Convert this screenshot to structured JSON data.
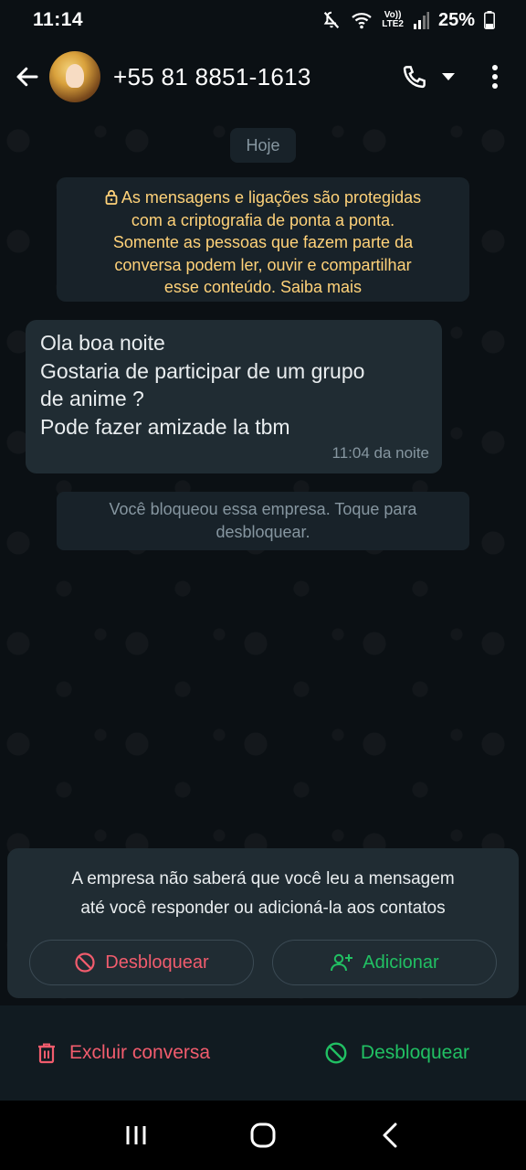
{
  "status_bar": {
    "time": "11:14",
    "network_top": "Vo))",
    "network_bottom": "LTE2",
    "battery": "25%"
  },
  "header": {
    "contact_name": "+55 81 8851-1613",
    "icons": [
      "back-arrow-icon",
      "avatar",
      "phone-icon",
      "dropdown-caret-icon",
      "more-vert-icon"
    ]
  },
  "chat": {
    "date_chip": "Hoje",
    "encryption_notice": [
      "As mensagens e ligações são protegidas",
      "com a criptografia de ponta a ponta.",
      "Somente as pessoas que fazem parte da",
      "conversa podem ler, ouvir e compartilhar",
      "esse conteúdo. Saiba mais"
    ],
    "message": {
      "lines": [
        "Ola boa noite",
        "Gostaria de participar de um grupo",
        "de anime ?",
        "Pode fazer amizade la tbm"
      ],
      "time": "11:04 da noite"
    },
    "block_notice": [
      "Você bloqueou essa empresa. Toque para",
      "desbloquear."
    ]
  },
  "info_card": {
    "text_lines": [
      "A empresa não saberá que você leu a mensagem",
      "até você responder ou adicioná-la aos contatos"
    ],
    "unblock_label": "Desbloquear",
    "add_label": "Adicionar"
  },
  "bottom_bar": {
    "delete_label": "Excluir conversa",
    "unblock_label": "Desbloquear"
  },
  "colors": {
    "background": "#0b1014",
    "bubble": "#202c33",
    "system_chip": "#182229",
    "encryption_text": "#ffd279",
    "danger": "#f15c6d",
    "accent_green": "#21c063",
    "muted_text": "#8696a0"
  }
}
